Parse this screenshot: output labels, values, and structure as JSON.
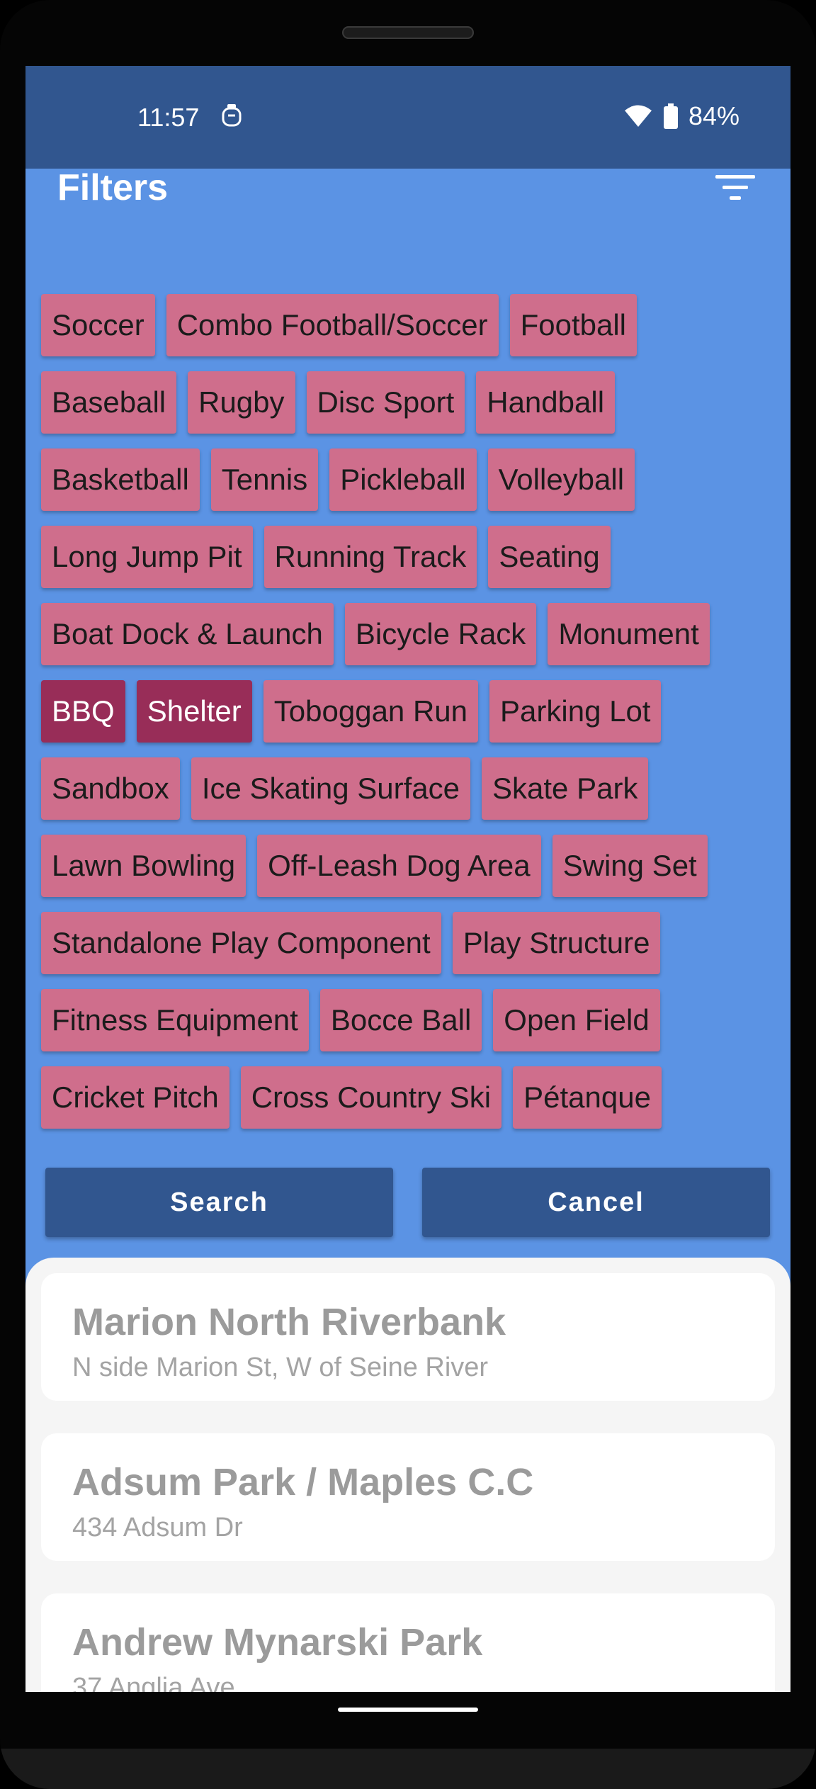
{
  "status_bar": {
    "time": "11:57",
    "battery": "84%"
  },
  "header": {
    "title": "Filters"
  },
  "chip_rows": [
    [
      {
        "label": "Soccer",
        "selected": false
      },
      {
        "label": "Combo Football/Soccer",
        "selected": false
      },
      {
        "label": "Football",
        "selected": false
      }
    ],
    [
      {
        "label": "Baseball",
        "selected": false
      },
      {
        "label": "Rugby",
        "selected": false
      },
      {
        "label": "Disc Sport",
        "selected": false
      },
      {
        "label": "Handball",
        "selected": false
      }
    ],
    [
      {
        "label": "Basketball",
        "selected": false
      },
      {
        "label": "Tennis",
        "selected": false
      },
      {
        "label": "Pickleball",
        "selected": false
      },
      {
        "label": "Volleyball",
        "selected": false
      }
    ],
    [
      {
        "label": "Long Jump Pit",
        "selected": false
      },
      {
        "label": "Running Track",
        "selected": false
      },
      {
        "label": "Seating",
        "selected": false
      }
    ],
    [
      {
        "label": "Boat Dock & Launch",
        "selected": false
      },
      {
        "label": "Bicycle Rack",
        "selected": false
      },
      {
        "label": "Monument",
        "selected": false
      }
    ],
    [
      {
        "label": "BBQ",
        "selected": true
      },
      {
        "label": "Shelter",
        "selected": true
      },
      {
        "label": "Toboggan Run",
        "selected": false
      },
      {
        "label": "Parking Lot",
        "selected": false
      }
    ],
    [
      {
        "label": "Sandbox",
        "selected": false
      },
      {
        "label": "Ice Skating Surface",
        "selected": false
      },
      {
        "label": "Skate Park",
        "selected": false
      }
    ],
    [
      {
        "label": "Lawn Bowling",
        "selected": false
      },
      {
        "label": "Off-Leash Dog Area",
        "selected": false
      },
      {
        "label": "Swing Set",
        "selected": false
      }
    ],
    [
      {
        "label": "Standalone Play Component",
        "selected": false
      },
      {
        "label": "Play Structure",
        "selected": false
      }
    ],
    [
      {
        "label": "Fitness Equipment",
        "selected": false
      },
      {
        "label": "Bocce Ball",
        "selected": false
      },
      {
        "label": "Open Field",
        "selected": false
      }
    ],
    [
      {
        "label": "Cricket Pitch",
        "selected": false
      },
      {
        "label": "Cross Country Ski",
        "selected": false
      },
      {
        "label": "Pétanque",
        "selected": false
      }
    ]
  ],
  "actions": {
    "search": "Search",
    "cancel": "Cancel"
  },
  "parks": [
    {
      "name": "Marion North Riverbank",
      "address": "N side Marion St, W of Seine River"
    },
    {
      "name": "Adsum Park / Maples C.C",
      "address": "434 Adsum Dr"
    },
    {
      "name": "Andrew Mynarski Park",
      "address": "37 Anglia Ave"
    }
  ],
  "colors": {
    "chip": "#cf6e8c",
    "chip_selected": "#982d58",
    "header_bg": "#5b93e4",
    "status_bg": "#31568f",
    "button_bg": "#31568f"
  }
}
